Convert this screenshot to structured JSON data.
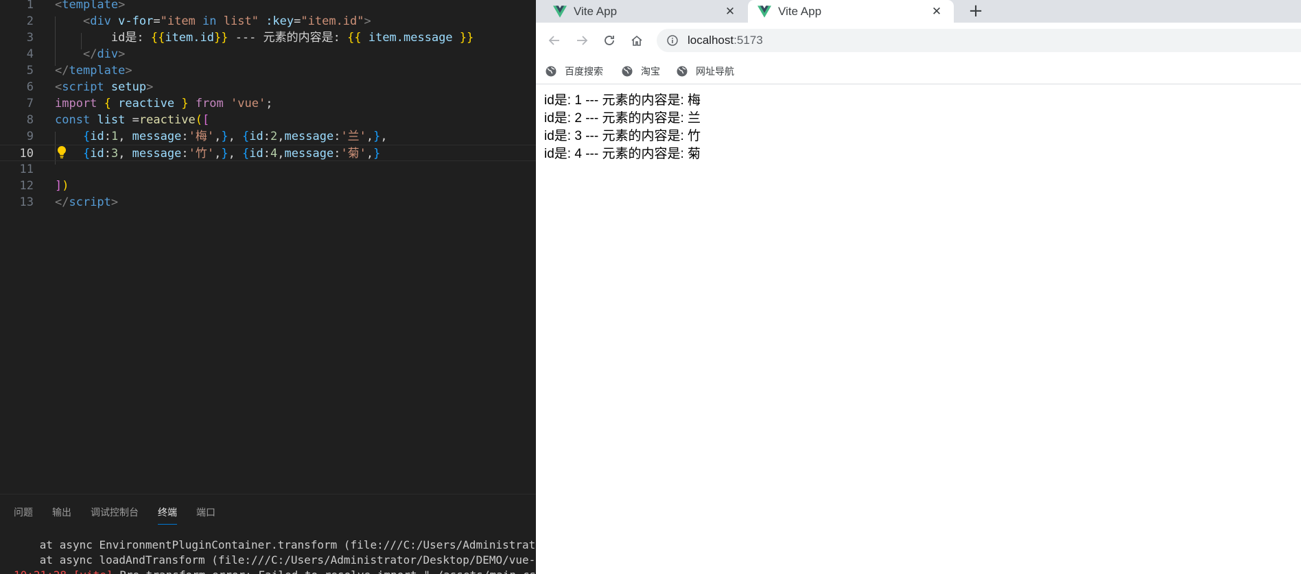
{
  "editor": {
    "lines": [
      {
        "n": "1",
        "tokens": [
          [
            "k-bracket",
            "<"
          ],
          [
            "k-tag",
            "template"
          ],
          [
            "k-bracket",
            ">"
          ]
        ]
      },
      {
        "n": "2",
        "tokens": [
          [
            "k-text",
            "    "
          ],
          [
            "k-bracket",
            "<"
          ],
          [
            "k-tag",
            "div"
          ],
          [
            "k-text",
            " "
          ],
          [
            "k-attr",
            "v-for"
          ],
          [
            "k-text",
            "="
          ],
          [
            "k-str",
            "\"item "
          ],
          [
            "k-decl",
            "in"
          ],
          [
            "k-str",
            " list\""
          ],
          [
            "k-text",
            " "
          ],
          [
            "k-attr",
            ":key"
          ],
          [
            "k-text",
            "="
          ],
          [
            "k-str",
            "\"item.id\""
          ],
          [
            "k-bracket",
            ">"
          ]
        ]
      },
      {
        "n": "3",
        "tokens": [
          [
            "k-text",
            "        id是: "
          ],
          [
            "k-b1",
            "{{"
          ],
          [
            "k-var",
            "item.id"
          ],
          [
            "k-b1",
            "}}"
          ],
          [
            "k-text",
            " --- 元素的内容是: "
          ],
          [
            "k-b1",
            "{{"
          ],
          [
            "k-text",
            " "
          ],
          [
            "k-var",
            "item.message"
          ],
          [
            "k-text",
            " "
          ],
          [
            "k-b1",
            "}}"
          ]
        ]
      },
      {
        "n": "4",
        "tokens": [
          [
            "k-text",
            "    "
          ],
          [
            "k-bracket",
            "</"
          ],
          [
            "k-tag",
            "div"
          ],
          [
            "k-bracket",
            ">"
          ]
        ]
      },
      {
        "n": "5",
        "tokens": [
          [
            "k-bracket",
            "</"
          ],
          [
            "k-tag",
            "template"
          ],
          [
            "k-bracket",
            ">"
          ]
        ]
      },
      {
        "n": "6",
        "tokens": [
          [
            "k-bracket",
            "<"
          ],
          [
            "k-tag",
            "script"
          ],
          [
            "k-text",
            " "
          ],
          [
            "k-attr",
            "setup"
          ],
          [
            "k-bracket",
            ">"
          ]
        ]
      },
      {
        "n": "7",
        "tokens": [
          [
            "k-kw",
            "import"
          ],
          [
            "k-text",
            " "
          ],
          [
            "k-b1",
            "{"
          ],
          [
            "k-text",
            " "
          ],
          [
            "k-var",
            "reactive"
          ],
          [
            "k-text",
            " "
          ],
          [
            "k-b1",
            "}"
          ],
          [
            "k-text",
            " "
          ],
          [
            "k-kw",
            "from"
          ],
          [
            "k-text",
            " "
          ],
          [
            "k-str",
            "'vue'"
          ],
          [
            "k-text",
            ";"
          ]
        ]
      },
      {
        "n": "8",
        "tokens": [
          [
            "k-decl",
            "const"
          ],
          [
            "k-text",
            " "
          ],
          [
            "k-var",
            "list"
          ],
          [
            "k-text",
            " ="
          ],
          [
            "k-fn",
            "reactive"
          ],
          [
            "k-b1",
            "("
          ],
          [
            "k-b2",
            "["
          ]
        ]
      },
      {
        "n": "9",
        "tokens": [
          [
            "k-text",
            "    "
          ],
          [
            "k-b3",
            "{"
          ],
          [
            "k-var",
            "id"
          ],
          [
            "k-text",
            ":"
          ],
          [
            "k-num",
            "1"
          ],
          [
            "k-text",
            ", "
          ],
          [
            "k-var",
            "message"
          ],
          [
            "k-text",
            ":"
          ],
          [
            "k-str",
            "'梅'"
          ],
          [
            "k-text",
            ","
          ],
          [
            "k-b3",
            "}"
          ],
          [
            "k-text",
            ", "
          ],
          [
            "k-b3",
            "{"
          ],
          [
            "k-var",
            "id"
          ],
          [
            "k-text",
            ":"
          ],
          [
            "k-num",
            "2"
          ],
          [
            "k-text",
            ","
          ],
          [
            "k-var",
            "message"
          ],
          [
            "k-text",
            ":"
          ],
          [
            "k-str",
            "'兰'"
          ],
          [
            "k-text",
            ","
          ],
          [
            "k-b3",
            "}"
          ],
          [
            "k-text",
            ","
          ]
        ]
      },
      {
        "n": "10",
        "tokens": [
          [
            "k-text",
            "    "
          ],
          [
            "k-b3",
            "{"
          ],
          [
            "k-var",
            "id"
          ],
          [
            "k-text",
            ":"
          ],
          [
            "k-num",
            "3"
          ],
          [
            "k-text",
            ", "
          ],
          [
            "k-var",
            "message"
          ],
          [
            "k-text",
            ":"
          ],
          [
            "k-str",
            "'竹'"
          ],
          [
            "k-text",
            ","
          ],
          [
            "k-b3",
            "}"
          ],
          [
            "k-text",
            ", "
          ],
          [
            "k-b3",
            "{"
          ],
          [
            "k-var",
            "id"
          ],
          [
            "k-text",
            ":"
          ],
          [
            "k-num",
            "4"
          ],
          [
            "k-text",
            ","
          ],
          [
            "k-var",
            "message"
          ],
          [
            "k-text",
            ":"
          ],
          [
            "k-str",
            "'菊'"
          ],
          [
            "k-text",
            ","
          ],
          [
            "k-b3",
            "}"
          ]
        ]
      },
      {
        "n": "11",
        "tokens": []
      },
      {
        "n": "12",
        "tokens": [
          [
            "k-b2",
            "]"
          ],
          [
            "k-b1",
            ")"
          ]
        ]
      },
      {
        "n": "13",
        "tokens": [
          [
            "k-bracket",
            "</"
          ],
          [
            "k-tag",
            "script"
          ],
          [
            "k-bracket",
            ">"
          ]
        ]
      }
    ],
    "current_line": "10",
    "lightbulb_icon": "lightbulb-icon"
  },
  "panel": {
    "tabs": [
      {
        "label": "问题",
        "active": false
      },
      {
        "label": "输出",
        "active": false
      },
      {
        "label": "调试控制台",
        "active": false
      },
      {
        "label": "终端",
        "active": true
      },
      {
        "label": "端口",
        "active": false
      }
    ],
    "terminal_lines": [
      "      at async EnvironmentPluginContainer.transform (file:///C:/Users/Administrator/D",
      "      at async loadAndTransform (file:///C:/Users/Administrator/Desktop/DEMO/vue-proj"
    ],
    "terminal_error": {
      "time": "10:21:28",
      "tag": "[vite]",
      "text": " Pre-transform error: Failed to resolve import \"./assets/main.css\" fro"
    }
  },
  "browser": {
    "tabs": [
      {
        "title": "Vite App",
        "active": false
      },
      {
        "title": "Vite App",
        "active": true
      }
    ],
    "new_tab_label": "+",
    "close_label": "✕",
    "url_host": "localhost",
    "url_port": ":5173",
    "bookmarks": [
      "百度搜索",
      "淘宝",
      "网址导航"
    ],
    "content_lines": [
      "id是: 1 --- 元素的内容是: 梅",
      "id是: 2 --- 元素的内容是: 兰",
      "id是: 3 --- 元素的内容是: 竹",
      "id是: 4 --- 元素的内容是: 菊"
    ]
  },
  "colors": {
    "editor_bg": "#1f1f1f",
    "vue_green": "#41b883",
    "vue_dark": "#35495e",
    "lightbulb": "#ffcc00",
    "active_tab_underline": "#0078d4"
  }
}
